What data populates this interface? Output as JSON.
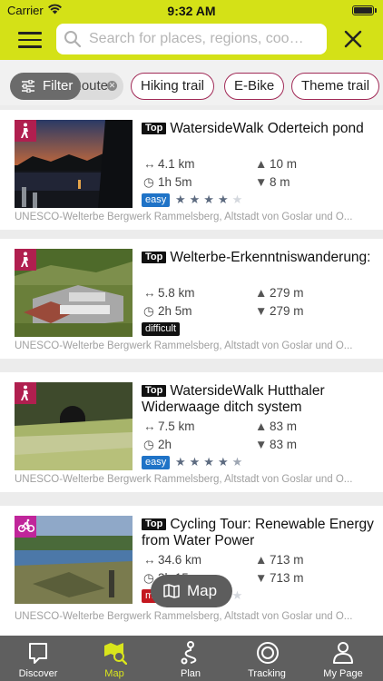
{
  "status_bar": {
    "carrier": "Carrier",
    "time": "9:32 AM"
  },
  "search": {
    "placeholder": "Search for places, regions, coo…"
  },
  "filters": {
    "filter_label": "Filter",
    "chips": [
      "Route",
      "Hiking trail",
      "E-Bike",
      "Theme trail"
    ]
  },
  "results": [
    {
      "type": "hiking-icon",
      "top_label": "Top",
      "title": "WatersideWalk Oderteich pond",
      "distance": "4.1 km",
      "duration": "1h 5m",
      "ascent": "10 m",
      "descent": "8 m",
      "difficulty": "easy",
      "rating": 4,
      "region": "UNESCO-Welterbe Bergwerk Rammelsberg, Altstadt von Goslar und O..."
    },
    {
      "type": "hiking-icon",
      "top_label": "Top",
      "title": "Welterbe-Erkenntniswanderung:",
      "distance": "5.8 km",
      "duration": "2h 5m",
      "ascent": "279 m",
      "descent": "279 m",
      "difficulty": "difficult",
      "rating": null,
      "region": "UNESCO-Welterbe Bergwerk Rammelsberg, Altstadt von Goslar und O..."
    },
    {
      "type": "hiking-icon",
      "top_label": "Top",
      "title": "WatersideWalk Hutthaler Widerwaage ditch system",
      "distance": "7.5 km",
      "duration": "2h",
      "ascent": "83 m",
      "descent": "83 m",
      "difficulty": "easy",
      "rating": 4.5,
      "region": "UNESCO-Welterbe Bergwerk Rammelsberg, Altstadt von Goslar und O..."
    },
    {
      "type": "bike-icon",
      "top_label": "Top",
      "title": "Cycling Tour: Renewable Energy from Water Power",
      "distance": "34.6 km",
      "duration": "3h 15m",
      "ascent": "713 m",
      "descent": "713 m",
      "difficulty": "medium",
      "rating": 3,
      "region": "UNESCO-Welterbe Bergwerk Rammelsberg, Altstadt von Goslar und O..."
    }
  ],
  "map_button": {
    "label": "Map"
  },
  "tabs": [
    {
      "label": "Discover",
      "icon": "bookmark-icon",
      "active": false
    },
    {
      "label": "Map",
      "icon": "map-search-icon",
      "active": true
    },
    {
      "label": "Plan",
      "icon": "route-icon",
      "active": false
    },
    {
      "label": "Tracking",
      "icon": "tracking-icon",
      "active": false
    },
    {
      "label": "My Page",
      "icon": "user-icon",
      "active": false
    }
  ],
  "colors": {
    "header": "#d4e117",
    "accent": "#d9e51c",
    "chip_border": "#a12a57",
    "tabbar": "#5f5f5f"
  }
}
